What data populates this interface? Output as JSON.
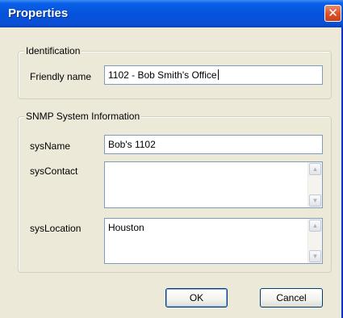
{
  "window": {
    "title": "Properties",
    "close_glyph": "✕"
  },
  "identification": {
    "legend": "Identification",
    "friendly_name_label": "Friendly name",
    "friendly_name_value": "1102 - Bob Smith's Office"
  },
  "snmp": {
    "legend": "SNMP System Information",
    "sysname_label": "sysName",
    "sysname_value": "Bob's 1102",
    "syscontact_label": "sysContact",
    "syscontact_value": "",
    "syslocation_label": "sysLocation",
    "syslocation_value": "Houston"
  },
  "buttons": {
    "ok_label": "OK",
    "cancel_label": "Cancel"
  },
  "icons": {
    "scroll_up": "▲",
    "scroll_down": "▼"
  },
  "colors": {
    "titlebar": "#0553dc",
    "close_button": "#d9522c",
    "dialog_background": "#ece9d8",
    "field_border": "#7f9db9"
  }
}
